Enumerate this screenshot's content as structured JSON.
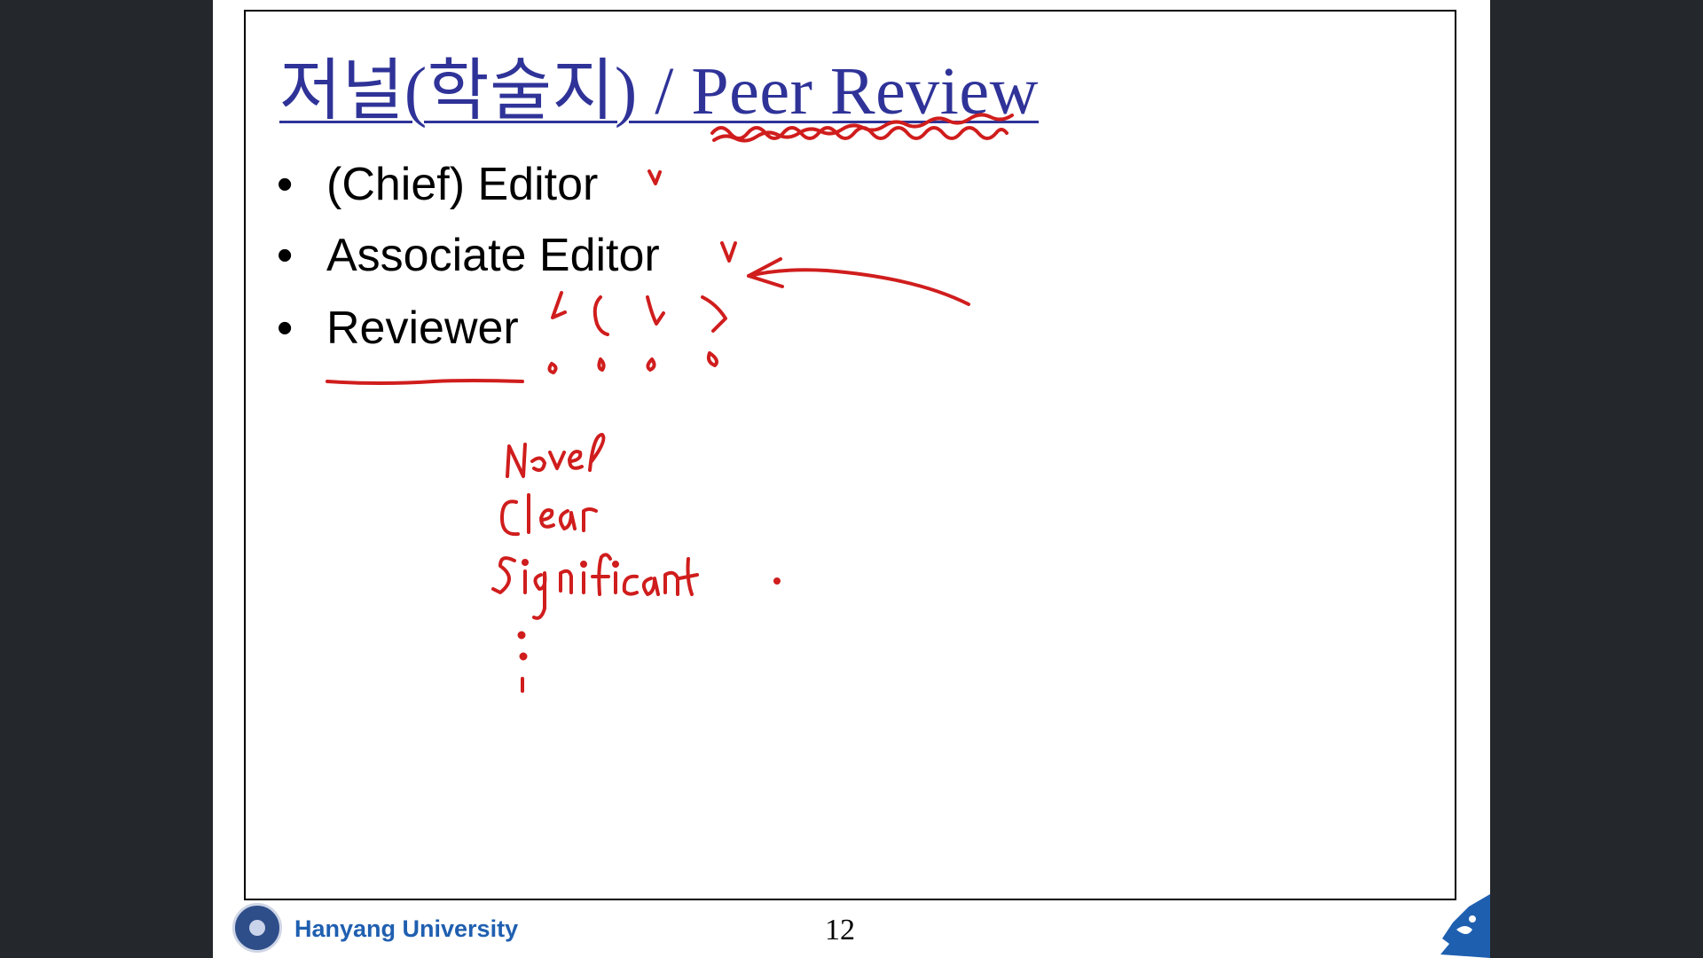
{
  "slide": {
    "title": "저널(학술지) / Peer Review",
    "bullets": [
      {
        "marker": "•",
        "text": "(Chief) Editor"
      },
      {
        "marker": "•",
        "text": "Associate Editor"
      },
      {
        "marker": "•",
        "text": "Reviewer"
      }
    ],
    "page_number": "12"
  },
  "footer": {
    "university": "Hanyang University",
    "logo_icon": "university-seal-icon",
    "mascot_icon": "lion-mascot-icon"
  },
  "annotations": {
    "ink_color": "#d01d1d",
    "handwritten_words": [
      "Novel",
      "Clear",
      "Significant"
    ]
  },
  "colors": {
    "title": "#2f3398",
    "footer_text": "#1f5fb0",
    "background": "#24272b"
  }
}
